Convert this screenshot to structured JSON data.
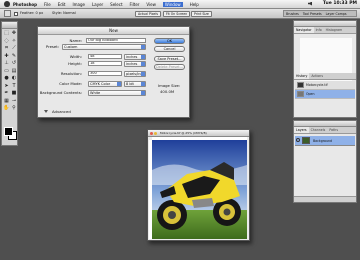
{
  "menubar": {
    "items": [
      "Photoshop",
      "File",
      "Edit",
      "Image",
      "Layer",
      "Select",
      "Filter",
      "View",
      "Window",
      "Help"
    ],
    "active_item": "Window",
    "clock": "Tue 10:33 PM"
  },
  "options_bar": {
    "checkbox_label": "Feather: 0 px",
    "style_label": "Style: Normal",
    "button_1": "Actual Pixels",
    "button_2": "Fit On Screen",
    "button_3": "Print Size",
    "palette_well_tabs": [
      "Brushes",
      "Tool Presets",
      "Layer Comps"
    ]
  },
  "new_dialog": {
    "title": "New",
    "name_label": "Name:",
    "name_value": "Our Big Billboard",
    "preset_label": "Preset:",
    "preset_value": "Custom",
    "width_label": "Width:",
    "width_value": "48",
    "width_unit": "inches",
    "height_label": "Height:",
    "height_value": "18",
    "height_unit": "inches",
    "resolution_label": "Resolution:",
    "resolution_value": "300",
    "resolution_unit": "pixels/inch",
    "color_mode_label": "Color Mode:",
    "color_mode_value": "CMYK Color",
    "bit_depth_value": "8 bit",
    "background_label": "Background Contents:",
    "background_value": "White",
    "advanced_label": "Advanced",
    "ok_label": "OK",
    "cancel_label": "Cancel",
    "save_preset_label": "Save Preset...",
    "delete_preset_label": "Delete Preset...",
    "image_size_label": "Image Size:",
    "image_size_value": "400.0M"
  },
  "photo_window": {
    "title": "Motorcycle.tif @ 25% (CMYK/8)"
  },
  "navigator_panel": {
    "tabs": [
      "Navigator",
      "Info",
      "Histogram"
    ],
    "history_tabs": [
      "History",
      "Actions"
    ],
    "history_items": [
      "Motorcycle.tif",
      "Open"
    ]
  },
  "layers_panel": {
    "tabs": [
      "Layers",
      "Channels",
      "Paths"
    ],
    "layer_name": "Background"
  },
  "colors": {
    "menu_highlight": "#3d6fd0",
    "ok_button": "#3f7fdc",
    "desktop": "#4f4f4f"
  }
}
